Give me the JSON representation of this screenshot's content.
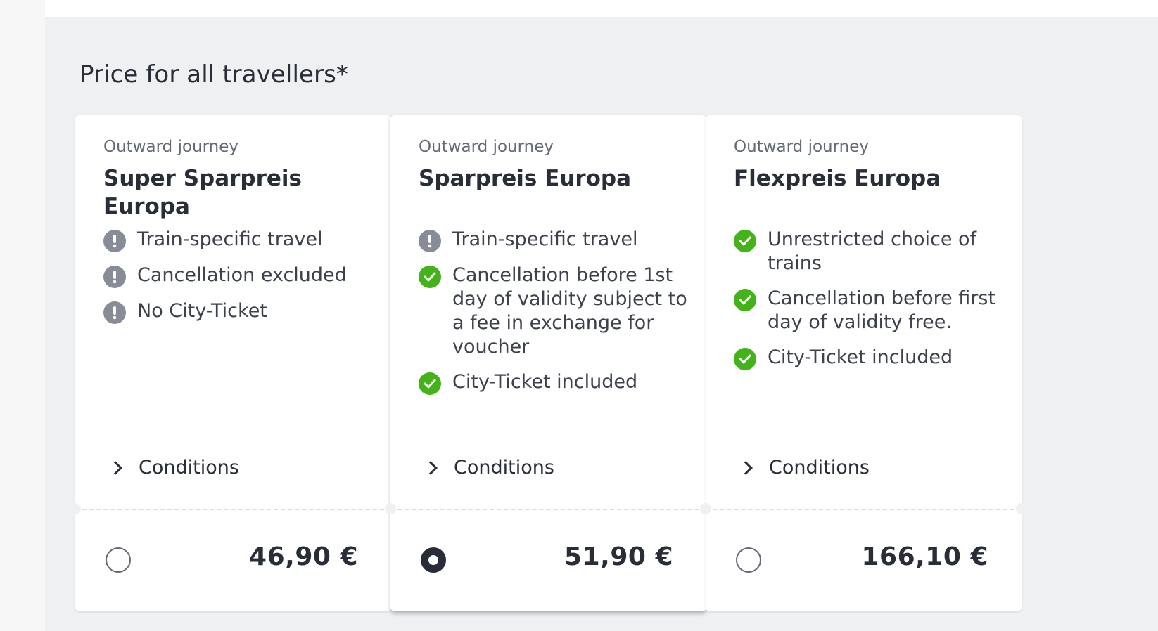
{
  "section": {
    "title": "Price for all travellers*"
  },
  "offers": [
    {
      "label": "Outward journey",
      "title": "Super Sparpreis Europa",
      "features": [
        {
          "icon": "exclamation-icon",
          "text": "Train-specific travel"
        },
        {
          "icon": "exclamation-icon",
          "text": "Cancellation excluded"
        },
        {
          "icon": "exclamation-icon",
          "text": "No City-Ticket"
        }
      ],
      "conditions_label": "Conditions",
      "price": "46,90 €",
      "selected": false
    },
    {
      "label": "Outward journey",
      "title": "Sparpreis Europa",
      "features": [
        {
          "icon": "exclamation-icon",
          "text": "Train-specific travel"
        },
        {
          "icon": "check-icon",
          "text": "Cancellation before 1st day of validity subject to a fee in exchange for voucher"
        },
        {
          "icon": "check-icon",
          "text": "City-Ticket included"
        }
      ],
      "conditions_label": "Conditions",
      "price": "51,90 €",
      "selected": true
    },
    {
      "label": "Outward journey",
      "title": "Flexpreis Europa",
      "features": [
        {
          "icon": "check-icon",
          "text": "Unrestricted choice of trains"
        },
        {
          "icon": "check-icon",
          "text": "Cancellation before first day of validity free."
        },
        {
          "icon": "check-icon",
          "text": "City-Ticket included"
        }
      ],
      "conditions_label": "Conditions",
      "price": "166,10 €",
      "selected": false
    }
  ],
  "colors": {
    "background": "#eef0f2",
    "card": "#ffffff",
    "text": "#282d37",
    "warning_icon": "#878c96",
    "success_icon": "#44b219"
  }
}
